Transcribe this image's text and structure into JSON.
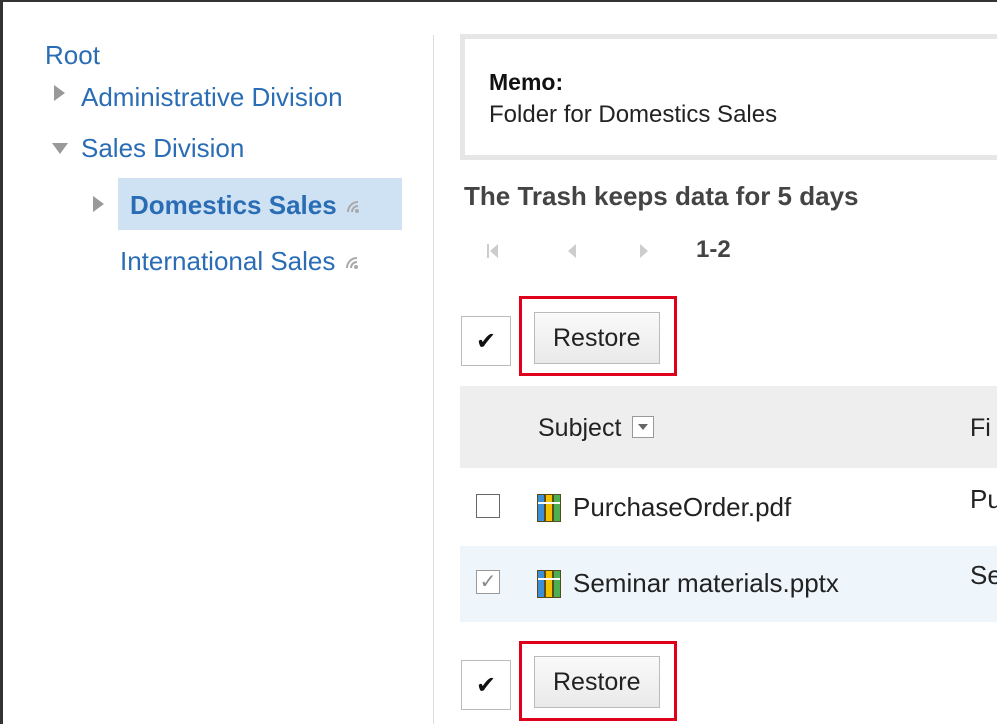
{
  "tree": {
    "root": "Root",
    "items": [
      {
        "label": "Administrative Division",
        "state": "collapsed"
      },
      {
        "label": "Sales Division",
        "state": "expanded"
      },
      {
        "label": "Domestics Sales",
        "state": "collapsed",
        "selected": true,
        "icon": "shared-signal-icon"
      },
      {
        "label": "International Sales",
        "state": "leaf",
        "icon": "shared-signal-icon"
      }
    ]
  },
  "memo": {
    "title": "Memo:",
    "text": "Folder for Domestics Sales"
  },
  "trash_notice": "The Trash keeps data for 5 days",
  "pager": {
    "first": "K",
    "prev": "◀",
    "next": "▶",
    "range": "1-2"
  },
  "toolbar_top": {
    "checkall": "✔",
    "restore_label": "Restore"
  },
  "toolbar_bottom": {
    "checkall": "✔",
    "restore_label": "Restore"
  },
  "table": {
    "columns": [
      {
        "label": "Subject",
        "sortable": true
      },
      {
        "label": "Fi"
      }
    ],
    "rows": [
      {
        "checked": false,
        "name": "PurchaseOrder.pdf",
        "col2": "Pu"
      },
      {
        "checked": true,
        "name": "Seminar materials.pptx",
        "col2": "Se"
      }
    ]
  },
  "colors": {
    "link": "#2a6db5",
    "highlight": "#cfe2f3",
    "callout": "#e0001b"
  }
}
